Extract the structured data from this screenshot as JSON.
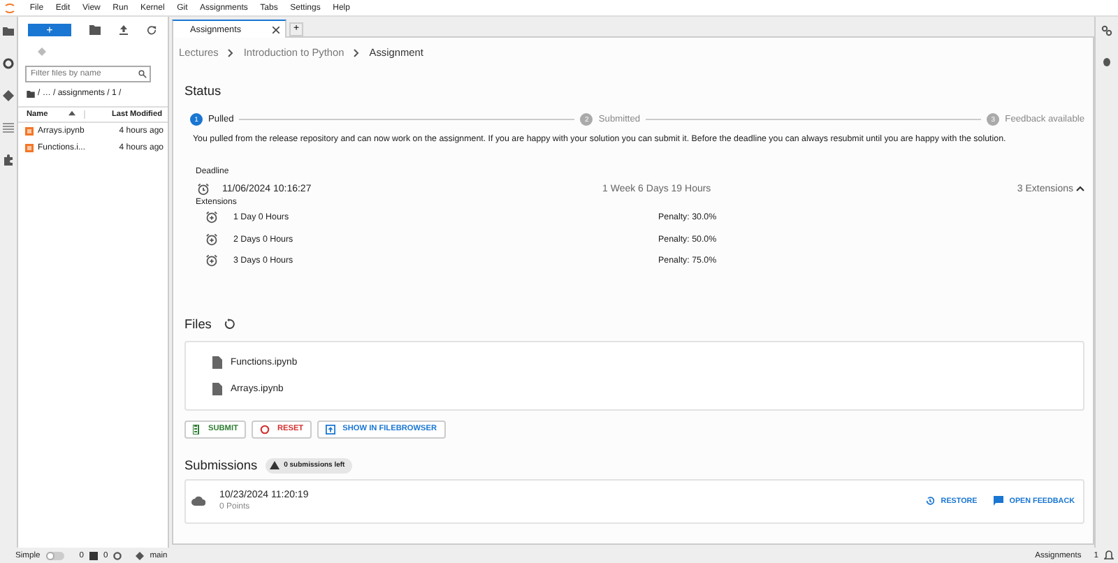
{
  "menu": [
    "File",
    "Edit",
    "View",
    "Run",
    "Kernel",
    "Git",
    "Assignments",
    "Tabs",
    "Settings",
    "Help"
  ],
  "file_browser": {
    "new_button": "+",
    "filter": {
      "placeholder": "Filter files by name"
    },
    "path": "/ … / assignments / 1 /",
    "columns": [
      "Name",
      "Last Modified"
    ],
    "rows": [
      {
        "name": "Arrays.ipynb",
        "modified": "4 hours ago"
      },
      {
        "name": "Functions.i...",
        "modified": "4 hours ago"
      }
    ]
  },
  "tabs": [
    {
      "label": "Assignments",
      "selected": true
    }
  ],
  "new_tab": "+",
  "breadcrumb": [
    "Lectures",
    "Introduction to Python",
    "Assignment"
  ],
  "status": {
    "title": "Status",
    "steps": [
      {
        "number": "1",
        "label": "Pulled",
        "active": true
      },
      {
        "number": "2",
        "label": "Submitted",
        "active": false
      },
      {
        "number": "3",
        "label": "Feedback available",
        "active": false
      }
    ],
    "description": "You pulled from the release repository and can now work on the assignment. If you are happy with your solution you can submit it. Before the deadline you can always resubmit until you are happy with the solution."
  },
  "deadline": {
    "label": "Deadline",
    "date": "11/06/2024 10:16:27",
    "remaining": "1 Week 6 Days 19 Hours",
    "extensions_toggle": "3 Extensions",
    "expanded": true,
    "extensions_label": "Extensions",
    "extensions": [
      {
        "duration": "1 Day 0 Hours",
        "penalty": "Penalty: 30.0%"
      },
      {
        "duration": "2 Days 0 Hours",
        "penalty": "Penalty: 50.0%"
      },
      {
        "duration": "3 Days 0 Hours",
        "penalty": "Penalty: 75.0%"
      }
    ]
  },
  "files": {
    "title": "Files",
    "items": [
      "Functions.ipynb",
      "Arrays.ipynb"
    ]
  },
  "buttons": [
    {
      "label": "SUBMIT",
      "kind": "submit"
    },
    {
      "label": "RESET",
      "kind": "reset"
    },
    {
      "label": "SHOW IN FILEBROWSER",
      "kind": "show"
    }
  ],
  "submissions": {
    "title": "Submissions",
    "badge": "0 submissions left",
    "items": [
      {
        "date": "10/23/2024 11:20:19",
        "points": "0 Points",
        "actions": [
          "RESTORE",
          "OPEN FEEDBACK"
        ]
      }
    ]
  },
  "status_bar": {
    "mode_label": "Simple",
    "simple_mode": false,
    "terminals": "0",
    "kernels": "0",
    "branch": "main",
    "right_label": "Assignments",
    "notifications": "1"
  }
}
